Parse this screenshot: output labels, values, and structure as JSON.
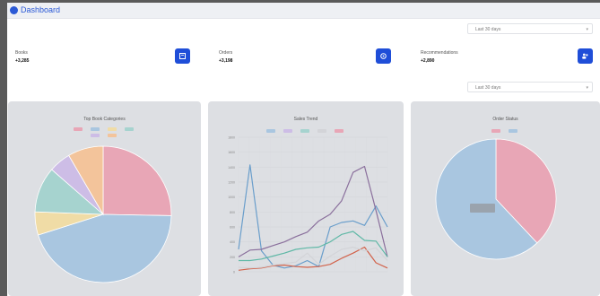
{
  "app": {
    "title": "Dashboard"
  },
  "filters": {
    "top_select": "Last 30 days",
    "second_select": "Last 30 days"
  },
  "kpis": [
    {
      "label": "Books",
      "value": "+3,285"
    },
    {
      "label": "Orders",
      "value": "+3,198"
    },
    {
      "label": "Recommendations",
      "value": "+2,890"
    }
  ],
  "charts": {
    "pie_left": {
      "title": "Top Book Categories"
    },
    "line_mid": {
      "title": "Sales Trend"
    },
    "pie_right": {
      "title": "Order Status"
    }
  },
  "colors": {
    "accent": "#1f4ed8",
    "pink": "#e8a6b6",
    "blue": "#a9c6e0",
    "teal": "#a6d3cf",
    "yellow": "#f0dca6",
    "purple": "#cdbde6",
    "grey": "#d3d4d8",
    "orange": "#f3c49b",
    "line_blue": "#6a9ecb",
    "line_purple": "#8a6f9c",
    "line_teal": "#5fb8a6",
    "line_red": "#d2624a"
  },
  "chart_data": [
    {
      "type": "pie",
      "title": "Top Book Categories",
      "slices": [
        {
          "color": "#e8a6b6",
          "value": 25.3
        },
        {
          "color": "#a9c6e0",
          "value": 44.8
        },
        {
          "color": "#f0dca6",
          "value": 5.5
        },
        {
          "color": "#a6d3cf",
          "value": 10.8
        },
        {
          "color": "#cdbde6",
          "value": 5.2
        },
        {
          "color": "#f3c49b",
          "value": 8.4
        }
      ]
    },
    {
      "type": "line",
      "title": "Sales Trend",
      "ylim": [
        0,
        1800
      ],
      "y_ticks": [
        1800,
        1600,
        1400,
        1200,
        1000,
        800,
        600,
        400,
        200,
        0
      ],
      "x_count": 15,
      "series": [
        {
          "color": "#6a9ecb",
          "values": [
            300,
            1430,
            280,
            90,
            50,
            80,
            150,
            70,
            600,
            660,
            680,
            620,
            880,
            600
          ]
        },
        {
          "color": "#8a6f9c",
          "values": [
            200,
            290,
            300,
            350,
            400,
            470,
            530,
            680,
            770,
            950,
            1330,
            1410,
            820,
            200
          ]
        },
        {
          "color": "#5fb8a6",
          "values": [
            150,
            150,
            170,
            210,
            250,
            300,
            320,
            330,
            400,
            500,
            540,
            420,
            410,
            200
          ]
        },
        {
          "color": "#d2624a",
          "values": [
            20,
            40,
            50,
            80,
            90,
            70,
            60,
            70,
            100,
            180,
            250,
            330,
            120,
            50
          ]
        },
        {
          "color": "#d3d4d8",
          "values": [
            60,
            50,
            60,
            90,
            110,
            130,
            250,
            100,
            210,
            300,
            330,
            280,
            320,
            150
          ]
        }
      ]
    },
    {
      "type": "pie",
      "title": "Order Status",
      "slices": [
        {
          "color": "#e8a6b6",
          "value": 38
        },
        {
          "color": "#a9c6e0",
          "value": 62
        }
      ]
    }
  ]
}
